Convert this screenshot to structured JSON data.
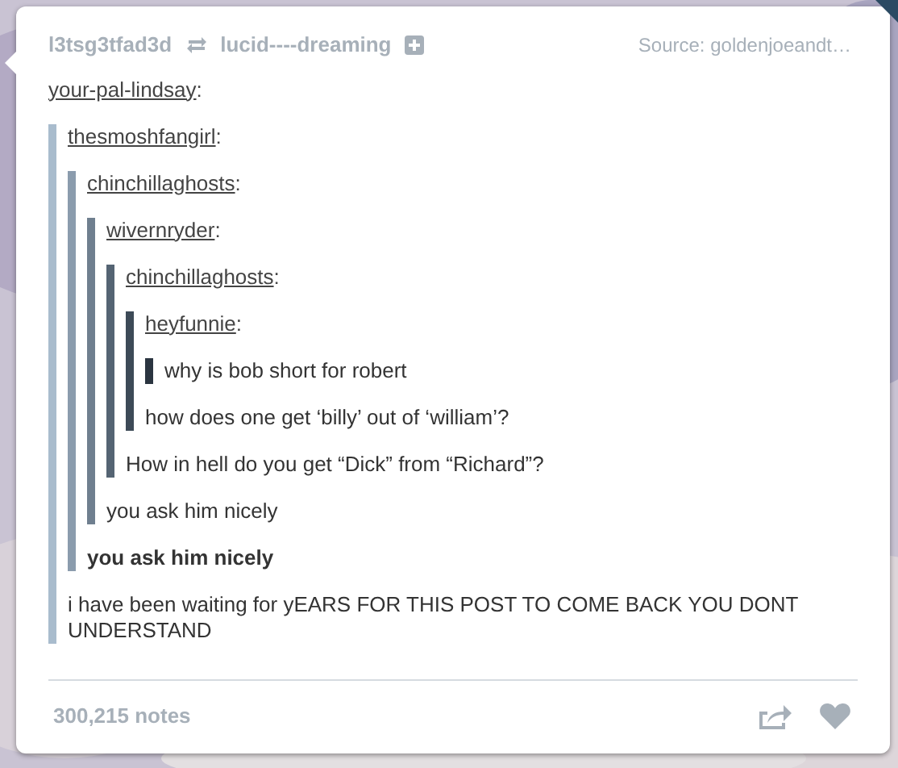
{
  "header": {
    "poster": "l3tsg3tfad3d",
    "reblogged_from": "lucid----dreaming",
    "source": "Source: goldenjoeandt…"
  },
  "thread": {
    "user": "your-pal-lindsay",
    "colon": ":",
    "quote": {
      "user": "thesmoshfangirl",
      "colon": ":",
      "text": "i have been waiting for yEARS FOR THIS POST TO COME BACK YOU DONT UNDERSTAND",
      "bold": false,
      "quote": {
        "user": "chinchillaghosts",
        "colon": ":",
        "text": "you ask him nicely",
        "bold": true,
        "quote": {
          "user": "wivernryder",
          "colon": ":",
          "text": "you ask him nicely",
          "bold": false,
          "quote": {
            "user": "chinchillaghosts",
            "colon": ":",
            "text": "How in hell do you get “Dick” from “Richard”?",
            "bold": false,
            "quote": {
              "user": "heyfunnie",
              "colon": ":",
              "text": "how does one get ‘billy’ out of ‘william’?",
              "bold": false,
              "quote": {
                "text": "why is bob short for robert",
                "bold": false
              }
            }
          }
        }
      }
    }
  },
  "footer": {
    "notes": "300,215 notes"
  }
}
